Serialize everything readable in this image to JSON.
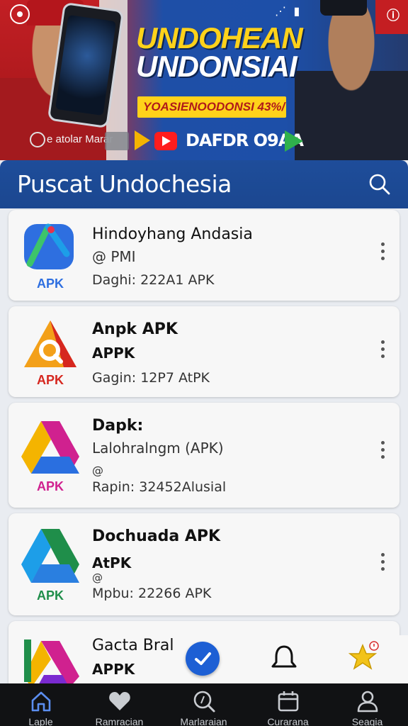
{
  "banner": {
    "headline_line1": "UNDOHEAN",
    "headline_line2": "UNDONSIAI",
    "tagline": "YOASIENOODONSI 43%/",
    "caption": "e atolar Marar",
    "cta": "DAFDR O9AA"
  },
  "header": {
    "title": "Puscat Undochesia"
  },
  "apps": [
    {
      "name": "Hindoyhang Andasia",
      "line2": "@ PMI",
      "meta": "Daghi: 222A1 APK",
      "badge": "APK",
      "color": "#2e6fe0"
    },
    {
      "name": "Anpk APK",
      "line2": "APPK",
      "meta": "Gagin: 12P7 AtPK",
      "badge": "APK",
      "color": "#e03a1e"
    },
    {
      "name": "Dapk:",
      "line2": "Lalohralngm (APK)",
      "line3": "@",
      "meta": "Rapin: 32452Alusial",
      "badge": "APK",
      "color": "#d0218f"
    },
    {
      "name": "Dochuada APK",
      "line2": "AtPK",
      "line3": "@",
      "meta": "Mpbu: 22266 APK",
      "badge": "APK",
      "color": "#1f8e4a"
    },
    {
      "name": "Gacta Bralar A",
      "line2": "APPK"
    }
  ],
  "nav": {
    "items": [
      {
        "label": "Laple",
        "icon": "home-icon"
      },
      {
        "label": "Ramracian",
        "icon": "heart-icon"
      },
      {
        "label": "Marlaraian",
        "icon": "search-icon"
      },
      {
        "label": "Curarana",
        "icon": "calendar-icon"
      },
      {
        "label": "Seagia",
        "icon": "profile-icon"
      }
    ]
  },
  "colors": {
    "header": "#1e4d9a",
    "accent_blue": "#1d5fd4",
    "star": "#f2c31a"
  }
}
